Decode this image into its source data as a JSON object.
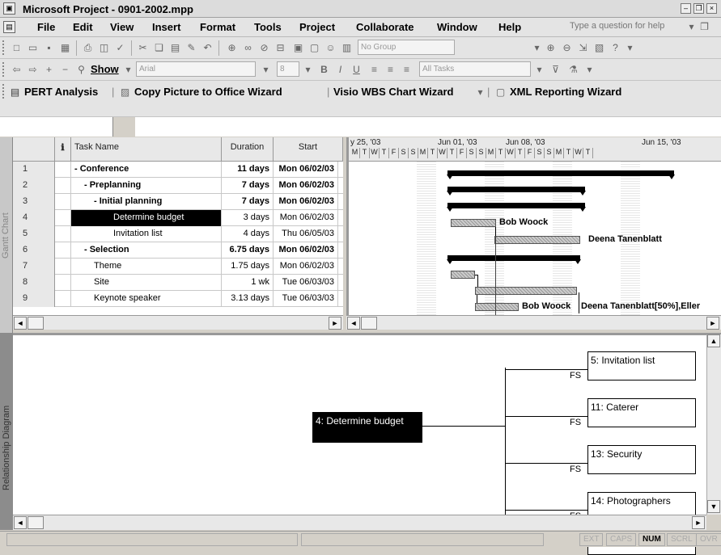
{
  "window": {
    "title": "Microsoft Project - 0901-2002.mpp"
  },
  "menu": {
    "items": [
      "File",
      "Edit",
      "View",
      "Insert",
      "Format",
      "Tools",
      "Project",
      "Collaborate",
      "Window",
      "Help"
    ],
    "ask_placeholder": "Type a question for help"
  },
  "toolbar1": {
    "group_value": "No Group"
  },
  "toolbar2": {
    "show_label": "Show",
    "font_value": "Arial",
    "size_value": "8",
    "filter_value": "All Tasks"
  },
  "toolbar3": {
    "items": [
      "PERT Analysis",
      "Copy Picture to Office Wizard",
      "Visio WBS Chart Wizard",
      "XML Reporting Wizard"
    ]
  },
  "views": {
    "gantt_label": "Gantt Chart",
    "relationship_label": "Relationship Diagram"
  },
  "table": {
    "headers": {
      "info": "ℹ",
      "name": "Task Name",
      "duration": "Duration",
      "start": "Start"
    },
    "rows": [
      {
        "id": "1",
        "name": "- Conference",
        "duration": "11 days",
        "start": "Mon 06/02/03",
        "bold": true,
        "indent": 0
      },
      {
        "id": "2",
        "name": "- Preplanning",
        "duration": "7 days",
        "start": "Mon 06/02/03",
        "bold": true,
        "indent": 1
      },
      {
        "id": "3",
        "name": "- Initial planning",
        "duration": "7 days",
        "start": "Mon 06/02/03",
        "bold": true,
        "indent": 2
      },
      {
        "id": "4",
        "name": "Determine budget",
        "duration": "3 days",
        "start": "Mon 06/02/03",
        "bold": false,
        "indent": 3,
        "selected": true
      },
      {
        "id": "5",
        "name": "Invitation list",
        "duration": "4 days",
        "start": "Thu 06/05/03",
        "bold": false,
        "indent": 3
      },
      {
        "id": "6",
        "name": "- Selection",
        "duration": "6.75 days",
        "start": "Mon 06/02/03",
        "bold": true,
        "indent": 1
      },
      {
        "id": "7",
        "name": "Theme",
        "duration": "1.75 days",
        "start": "Mon 06/02/03",
        "bold": false,
        "indent": 2
      },
      {
        "id": "8",
        "name": "Site",
        "duration": "1 wk",
        "start": "Tue 06/03/03",
        "bold": false,
        "indent": 2
      },
      {
        "id": "9",
        "name": "Keynote speaker",
        "duration": "3.13 days",
        "start": "Tue 06/03/03",
        "bold": false,
        "indent": 2
      }
    ]
  },
  "gantt": {
    "weeks": [
      "y 25, '03",
      "Jun 01, '03",
      "Jun 08, '03",
      "Jun 15, '03"
    ],
    "days": [
      "M",
      "T",
      "W",
      "T",
      "F",
      "S",
      "S",
      "M",
      "T",
      "W",
      "T",
      "F",
      "S",
      "S",
      "M",
      "T",
      "W",
      "T",
      "F",
      "S",
      "S",
      "M",
      "T",
      "W",
      "T"
    ],
    "labels": {
      "r4": "Bob Woock",
      "r5": "Deena Tanenblatt",
      "r9a": "Bob Woock",
      "r9b": "Deena Tanenblatt[50%],Eller"
    }
  },
  "relationship": {
    "center": "4: Determine budget",
    "successors": [
      {
        "label": "5: Invitation list",
        "type": "FS"
      },
      {
        "label": "11: Caterer",
        "type": "FS"
      },
      {
        "label": "13: Security",
        "type": "FS"
      },
      {
        "label": "14: Photographers",
        "type": "FS"
      }
    ]
  },
  "status": {
    "items": [
      "EXT",
      "CAPS",
      "NUM",
      "SCRL",
      "OVR"
    ],
    "active": "NUM"
  }
}
